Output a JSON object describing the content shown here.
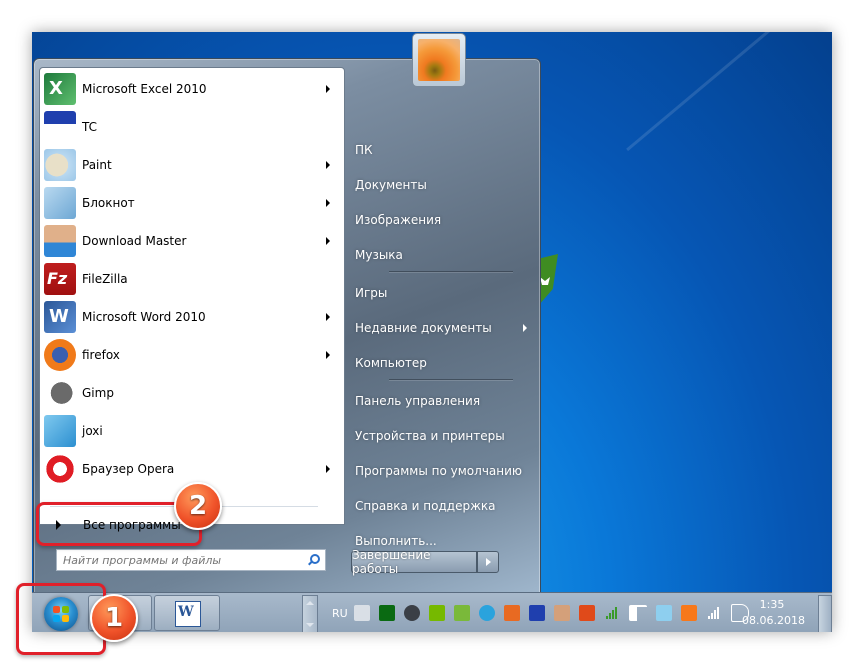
{
  "start_menu": {
    "pinned_programs": [
      {
        "label": "Microsoft Excel 2010",
        "icon": "excel-icon",
        "submenu": true
      },
      {
        "label": "TC",
        "icon": "total-commander-icon",
        "submenu": false
      },
      {
        "label": "Paint",
        "icon": "paint-icon",
        "submenu": true
      },
      {
        "label": "Блокнот",
        "icon": "notepad-icon",
        "submenu": true
      },
      {
        "label": "Download Master",
        "icon": "download-master-icon",
        "submenu": true
      },
      {
        "label": "FileZilla",
        "icon": "filezilla-icon",
        "submenu": false
      },
      {
        "label": "Microsoft Word 2010",
        "icon": "word-icon",
        "submenu": true
      },
      {
        "label": "firefox",
        "icon": "firefox-icon",
        "submenu": true
      },
      {
        "label": "Gimp",
        "icon": "gimp-icon",
        "submenu": false
      },
      {
        "label": "joxi",
        "icon": "joxi-icon",
        "submenu": false
      },
      {
        "label": "Браузер Opera",
        "icon": "opera-icon",
        "submenu": true
      }
    ],
    "all_programs_label": "Все программы",
    "search": {
      "placeholder": "Найти программы и файлы",
      "value": ""
    },
    "right_items": [
      {
        "label": "ПК",
        "submenu": false
      },
      {
        "label": "Документы",
        "submenu": false
      },
      {
        "label": "Изображения",
        "submenu": false
      },
      {
        "label": "Музыка",
        "submenu": false
      },
      {
        "label": "Игры",
        "submenu": false
      },
      {
        "label": "Недавние документы",
        "submenu": true
      },
      {
        "label": "Компьютер",
        "submenu": false
      },
      {
        "label": "Панель управления",
        "submenu": false
      },
      {
        "label": "Устройства и принтеры",
        "submenu": false
      },
      {
        "label": "Программы по умолчанию",
        "submenu": false
      },
      {
        "label": "Справка и поддержка",
        "submenu": false
      },
      {
        "label": "Выполнить...",
        "submenu": false
      }
    ],
    "shutdown_label": "Завершение работы"
  },
  "taskbar": {
    "pinned_apps": [
      {
        "name": "Microsoft Word 2010",
        "icon": "word-icon"
      }
    ],
    "language": "RU",
    "tray_icons": [
      "keyboard-icon",
      "green-grid-icon",
      "obs-icon",
      "nvidia-icon",
      "shield-check-icon",
      "telegram-icon",
      "java-icon",
      "floppy-icon",
      "download-master-icon",
      "network-share-icon",
      "signal-bars-icon",
      "action-center-flag-icon",
      "joxi-tray-icon",
      "avast-icon",
      "network-icon",
      "volume-icon"
    ],
    "clock": {
      "time": "1:35",
      "date": "08.06.2018"
    }
  },
  "annotations": {
    "step1": "1",
    "step2": "2"
  },
  "colors": {
    "highlight": "#e0202a",
    "badge": "#f0532a"
  }
}
